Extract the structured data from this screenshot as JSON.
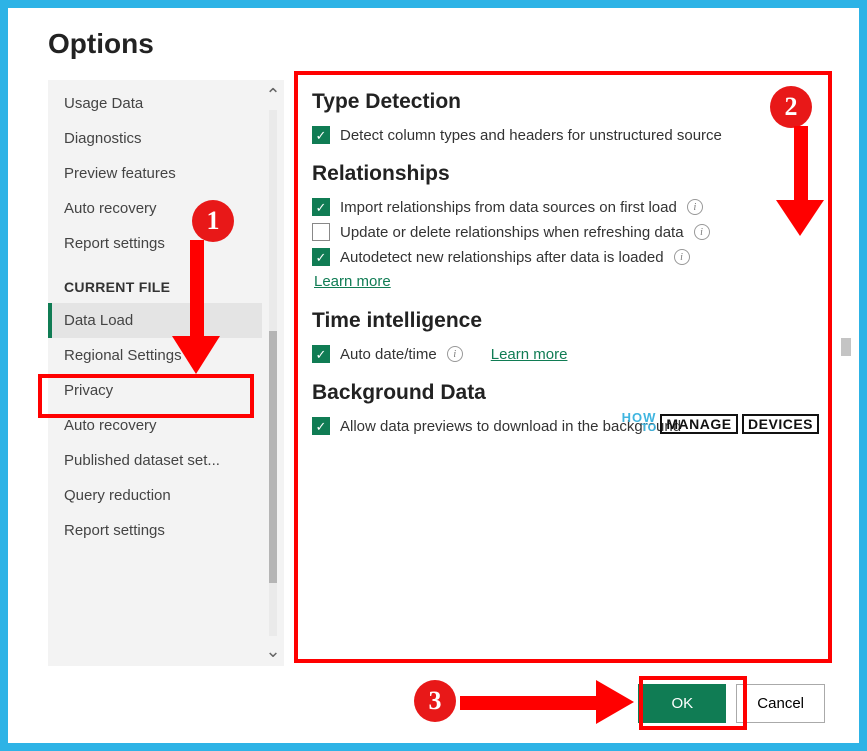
{
  "title": "Options",
  "sidebar": {
    "top_items": [
      "Usage Data",
      "Diagnostics",
      "Preview features",
      "Auto recovery",
      "Report settings"
    ],
    "section_header": "CURRENT FILE",
    "file_items": [
      "Data Load",
      "Regional Settings",
      "Privacy",
      "Auto recovery",
      "Published dataset set...",
      "Query reduction",
      "Report settings"
    ],
    "selected": "Data Load"
  },
  "main": {
    "type_detection": {
      "title": "Type Detection",
      "opt1": "Detect column types and headers for unstructured source"
    },
    "relationships": {
      "title": "Relationships",
      "opt1": "Import relationships from data sources on first load",
      "opt2": "Update or delete relationships when refreshing data",
      "opt3": "Autodetect new relationships after data is loaded",
      "learn": "Learn more"
    },
    "time": {
      "title": "Time intelligence",
      "opt1": "Auto date/time",
      "learn": "Learn more"
    },
    "background": {
      "title": "Background Data",
      "opt1": "Allow data previews to download in the background"
    }
  },
  "buttons": {
    "ok": "OK",
    "cancel": "Cancel"
  },
  "annotations": {
    "b1": "1",
    "b2": "2",
    "b3": "3"
  },
  "watermark": {
    "how": "HOW",
    "to": "TO",
    "manage": "MANAGE",
    "devices": "DEVICES"
  }
}
